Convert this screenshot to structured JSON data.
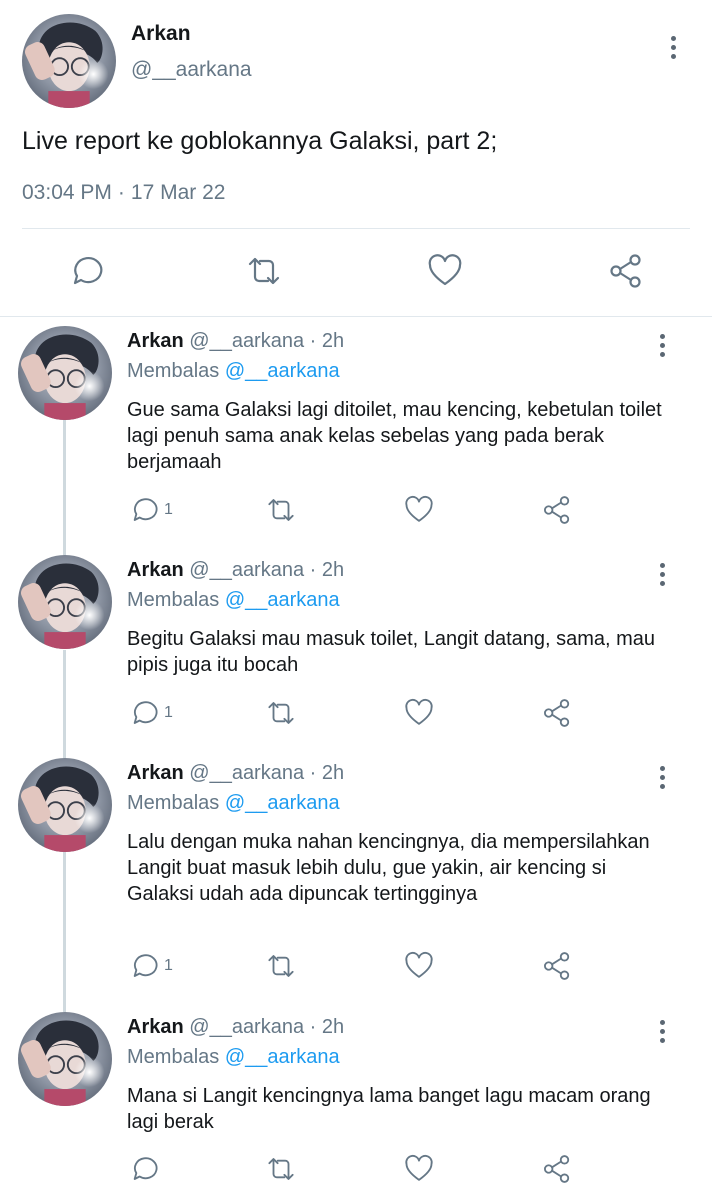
{
  "main_tweet": {
    "name": "Arkan",
    "handle": "@__aarkana",
    "text": "Live report ke goblokannya Galaksi, part 2;",
    "time": "03:04 PM",
    "separator": "·",
    "date": "17 Mar 22",
    "actions": [
      "comment-icon",
      "retweet-icon",
      "like-icon",
      "share-icon"
    ]
  },
  "replies": [
    {
      "name": "Arkan",
      "handle": "@__aarkana",
      "dot": "·",
      "time": "2h",
      "replying_prefix": "Membalas",
      "replying_to": "@__aarkana",
      "text": "Gue sama Galaksi lagi ditoilet, mau kencing, kebetulan toilet lagi penuh sama anak kelas sebelas yang pada berak berjamaah",
      "reply_count": "1"
    },
    {
      "name": "Arkan",
      "handle": "@__aarkana",
      "dot": "·",
      "time": "2h",
      "replying_prefix": "Membalas",
      "replying_to": "@__aarkana",
      "text": "Begitu Galaksi mau masuk toilet, Langit datang, sama, mau pipis juga itu bocah",
      "reply_count": "1"
    },
    {
      "name": "Arkan",
      "handle": "@__aarkana",
      "dot": "·",
      "time": "2h",
      "replying_prefix": "Membalas",
      "replying_to": "@__aarkana",
      "text": "Lalu dengan muka nahan kencingnya, dia mempersilahkan Langit buat masuk lebih dulu, gue yakin, air kencing si Galaksi udah ada dipuncak tertingginya",
      "reply_count": "1"
    },
    {
      "name": "Arkan",
      "handle": "@__aarkana",
      "dot": "·",
      "time": "2h",
      "replying_prefix": "Membalas",
      "replying_to": "@__aarkana",
      "text": "Mana si Langit kencingnya lama banget lagu macam orang lagi berak",
      "reply_count": ""
    }
  ],
  "colors": {
    "text": "#14171a",
    "secondary": "#657786",
    "accent": "#1d9bf0",
    "divider": "#e1e8ed"
  }
}
